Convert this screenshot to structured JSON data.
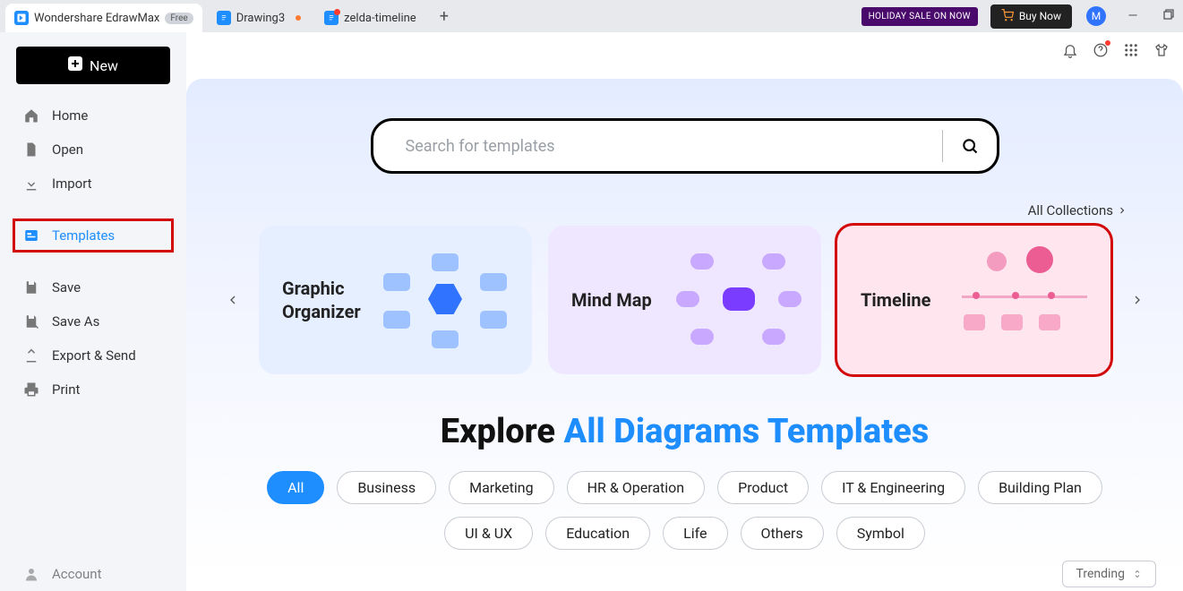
{
  "titlebar": {
    "app_name": "Wondershare EdrawMax",
    "free_label": "Free",
    "tabs": [
      {
        "label": "Drawing3",
        "modified": true
      },
      {
        "label": "zelda-timeline",
        "has_red": true
      }
    ],
    "holiday": "HOLIDAY SALE ON NOW",
    "buy": "Buy Now",
    "avatar": "M"
  },
  "sidebar": {
    "new_label": "New",
    "items": {
      "home": "Home",
      "open": "Open",
      "import": "Import",
      "templates": "Templates",
      "save": "Save",
      "saveas": "Save As",
      "export": "Export & Send",
      "print": "Print",
      "account": "Account"
    }
  },
  "search": {
    "placeholder": "Search for templates"
  },
  "all_collections": "All Collections",
  "cards": {
    "graphic_organizer": "Graphic\nOrganizer",
    "mind_map": "Mind Map",
    "timeline": "Timeline"
  },
  "explore": {
    "prefix": "Explore ",
    "blue": "All Diagrams Templates"
  },
  "pills": [
    "All",
    "Business",
    "Marketing",
    "HR & Operation",
    "Product",
    "IT & Engineering",
    "Building Plan",
    "UI & UX",
    "Education",
    "Life",
    "Others",
    "Symbol"
  ],
  "trending": "Trending"
}
